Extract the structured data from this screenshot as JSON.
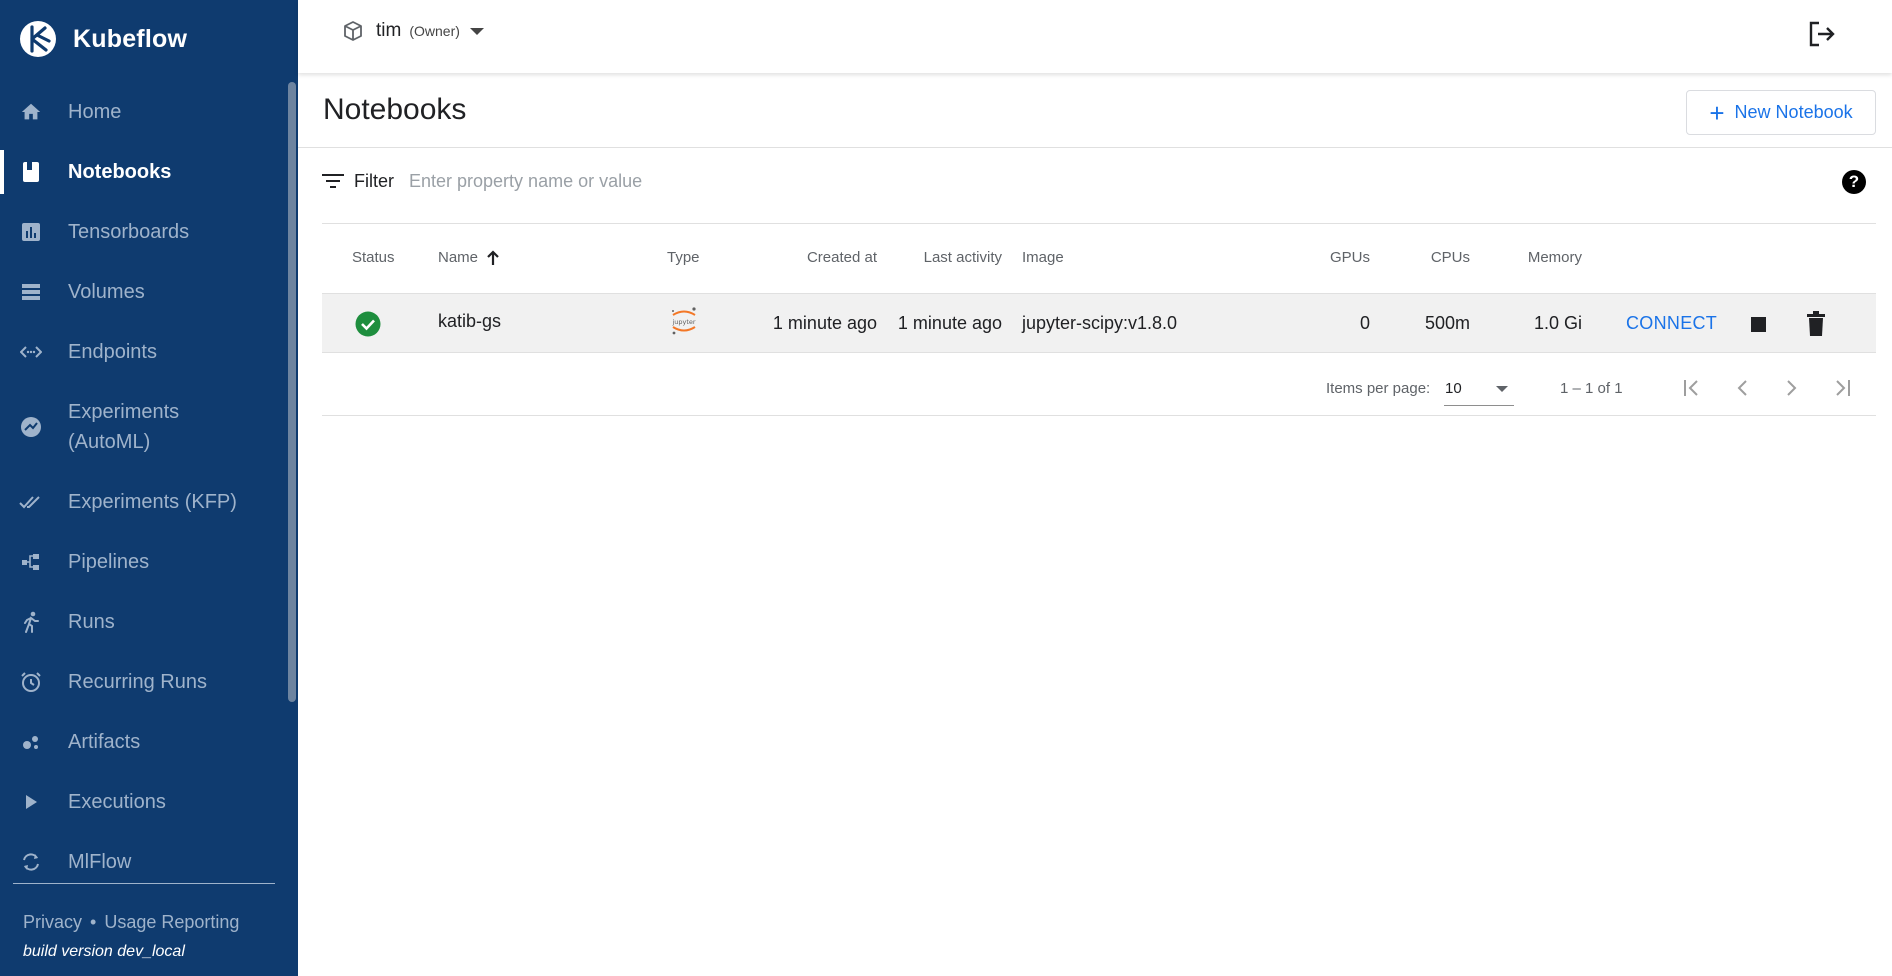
{
  "app": {
    "name": "Kubeflow"
  },
  "sidebar": {
    "items": [
      {
        "label": "Home",
        "icon": "home-icon"
      },
      {
        "label": "Notebooks",
        "icon": "notebook-icon",
        "active": true
      },
      {
        "label": "Tensorboards",
        "icon": "chart-icon"
      },
      {
        "label": "Volumes",
        "icon": "volumes-icon"
      },
      {
        "label": "Endpoints",
        "icon": "endpoints-icon"
      },
      {
        "label": "Experiments (AutoML)",
        "icon": "automl-icon"
      },
      {
        "label": "Experiments (KFP)",
        "icon": "done-all-icon"
      },
      {
        "label": "Pipelines",
        "icon": "pipelines-icon"
      },
      {
        "label": "Runs",
        "icon": "runs-icon"
      },
      {
        "label": "Recurring Runs",
        "icon": "alarm-icon"
      },
      {
        "label": "Artifacts",
        "icon": "artifacts-icon"
      },
      {
        "label": "Executions",
        "icon": "play-icon"
      },
      {
        "label": "MlFlow",
        "icon": "sync-icon"
      }
    ],
    "footer": {
      "privacy": "Privacy",
      "separator": "•",
      "usage": "Usage Reporting",
      "build": "build version dev_local"
    }
  },
  "topbar": {
    "namespace": "tim",
    "role": "(Owner)"
  },
  "page": {
    "title": "Notebooks",
    "new_button": "New Notebook"
  },
  "filter": {
    "label": "Filter",
    "placeholder": "Enter property name or value",
    "help": "?"
  },
  "table": {
    "headers": {
      "status": "Status",
      "name": "Name",
      "type": "Type",
      "created": "Created at",
      "activity": "Last activity",
      "image": "Image",
      "gpus": "GPUs",
      "cpus": "CPUs",
      "memory": "Memory"
    },
    "rows": [
      {
        "status": "ready",
        "name": "katib-gs",
        "type": "jupyter",
        "created": "1 minute ago",
        "activity": "1 minute ago",
        "image": "jupyter-scipy:v1.8.0",
        "gpus": "0",
        "cpus": "500m",
        "memory": "1.0 Gi",
        "connect": "CONNECT"
      }
    ]
  },
  "pagination": {
    "items_per_page_label": "Items per page:",
    "items_per_page": "10",
    "range": "1 – 1 of 1"
  },
  "colors": {
    "sidebar": "#0f3b6f",
    "accent": "#1a73e8",
    "status_ok": "#1e8e3e"
  }
}
